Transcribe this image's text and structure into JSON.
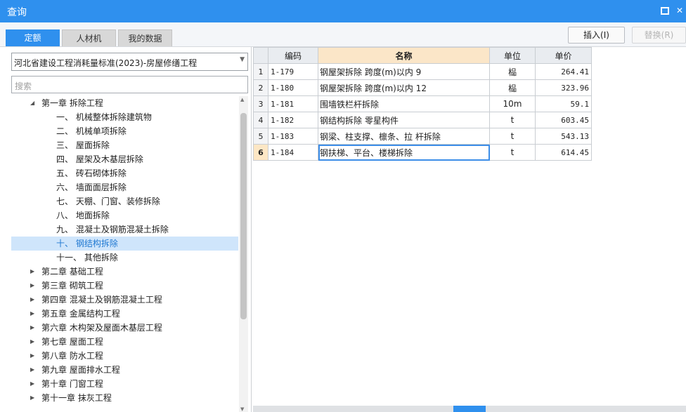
{
  "window": {
    "title": "查询"
  },
  "tabs": [
    {
      "label": "定额"
    },
    {
      "label": "人材机"
    },
    {
      "label": "我的数据"
    }
  ],
  "buttons": {
    "insert": "插入(I)",
    "replace": "替换(R)"
  },
  "library": {
    "selected": "河北省建设工程消耗量标准(2023)-房屋修缮工程"
  },
  "search": {
    "placeholder": "搜索"
  },
  "tree": [
    {
      "label": "第一章 拆除工程",
      "level": 0,
      "expanded": true
    },
    {
      "label": "一、 机械整体拆除建筑物",
      "level": 1
    },
    {
      "label": "二、 机械单项拆除",
      "level": 1
    },
    {
      "label": "三、 屋面拆除",
      "level": 1
    },
    {
      "label": "四、 屋架及木基层拆除",
      "level": 1
    },
    {
      "label": "五、 砖石砌体拆除",
      "level": 1
    },
    {
      "label": "六、 墙面面层拆除",
      "level": 1
    },
    {
      "label": "七、 天棚、门窗、装修拆除",
      "level": 1
    },
    {
      "label": "八、 地面拆除",
      "level": 1
    },
    {
      "label": "九、 混凝土及钢筋混凝土拆除",
      "level": 1
    },
    {
      "label": "十、 钢结构拆除",
      "level": 1,
      "selected": true
    },
    {
      "label": "十一、 其他拆除",
      "level": 1
    },
    {
      "label": "第二章 基础工程",
      "level": 0
    },
    {
      "label": "第三章 砌筑工程",
      "level": 0
    },
    {
      "label": "第四章 混凝土及钢筋混凝土工程",
      "level": 0
    },
    {
      "label": "第五章 金属结构工程",
      "level": 0
    },
    {
      "label": "第六章 木构架及屋面木基层工程",
      "level": 0
    },
    {
      "label": "第七章 屋面工程",
      "level": 0
    },
    {
      "label": "第八章 防水工程",
      "level": 0
    },
    {
      "label": "第九章 屋面排水工程",
      "level": 0
    },
    {
      "label": "第十章 门窗工程",
      "level": 0
    },
    {
      "label": "第十一章 抹灰工程",
      "level": 0
    }
  ],
  "table": {
    "columns": [
      "编码",
      "名称",
      "单位",
      "单价"
    ],
    "rows": [
      {
        "idx": "1",
        "code": "1-179",
        "name": "钢屋架拆除 跨度(m)以内 9",
        "unit": "榀",
        "price": "264.41"
      },
      {
        "idx": "2",
        "code": "1-180",
        "name": "钢屋架拆除 跨度(m)以内 12",
        "unit": "榀",
        "price": "323.96"
      },
      {
        "idx": "3",
        "code": "1-181",
        "name": "围墙铁栏杆拆除",
        "unit": "10m",
        "price": "59.1"
      },
      {
        "idx": "4",
        "code": "1-182",
        "name": "钢结构拆除 零星构件",
        "unit": "t",
        "price": "603.45"
      },
      {
        "idx": "5",
        "code": "1-183",
        "name": "钢梁、柱支撑、檩条、拉 杆拆除",
        "unit": "t",
        "price": "543.13"
      },
      {
        "idx": "6",
        "code": "1-184",
        "name": "钢扶梯、平台、楼梯拆除",
        "unit": "t",
        "price": "614.45"
      }
    ]
  },
  "colors": {
    "accent": "#2f90ee",
    "selection": "#cfe5fb",
    "header_sorted": "#fbe6c8"
  }
}
